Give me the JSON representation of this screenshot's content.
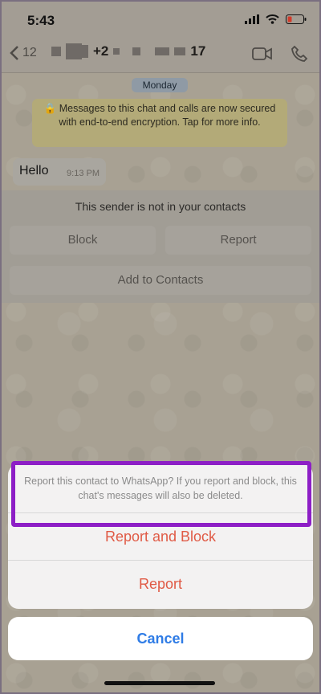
{
  "status": {
    "time": "5:43"
  },
  "nav": {
    "back_count": "12",
    "contact_name_partial": "+2",
    "contact_name_suffix": "17"
  },
  "chat": {
    "date_label": "Monday",
    "encryption_notice": "Messages to this chat and calls are now secured with end-to-end encryption. Tap for more info.",
    "messages": [
      {
        "text": "Hello",
        "time": "9:13 PM"
      }
    ]
  },
  "unknown_sender": {
    "note": "This sender is not in your contacts",
    "block_label": "Block",
    "report_label": "Report",
    "add_label": "Add to Contacts"
  },
  "action_sheet": {
    "message": "Report this contact to WhatsApp? If you report and block, this chat's messages will also be deleted.",
    "report_block_label": "Report and Block",
    "report_label": "Report",
    "cancel_label": "Cancel"
  },
  "colors": {
    "destructive": "#e05a45",
    "cancel": "#2f7ce6",
    "highlight": "#8d1fc6"
  }
}
